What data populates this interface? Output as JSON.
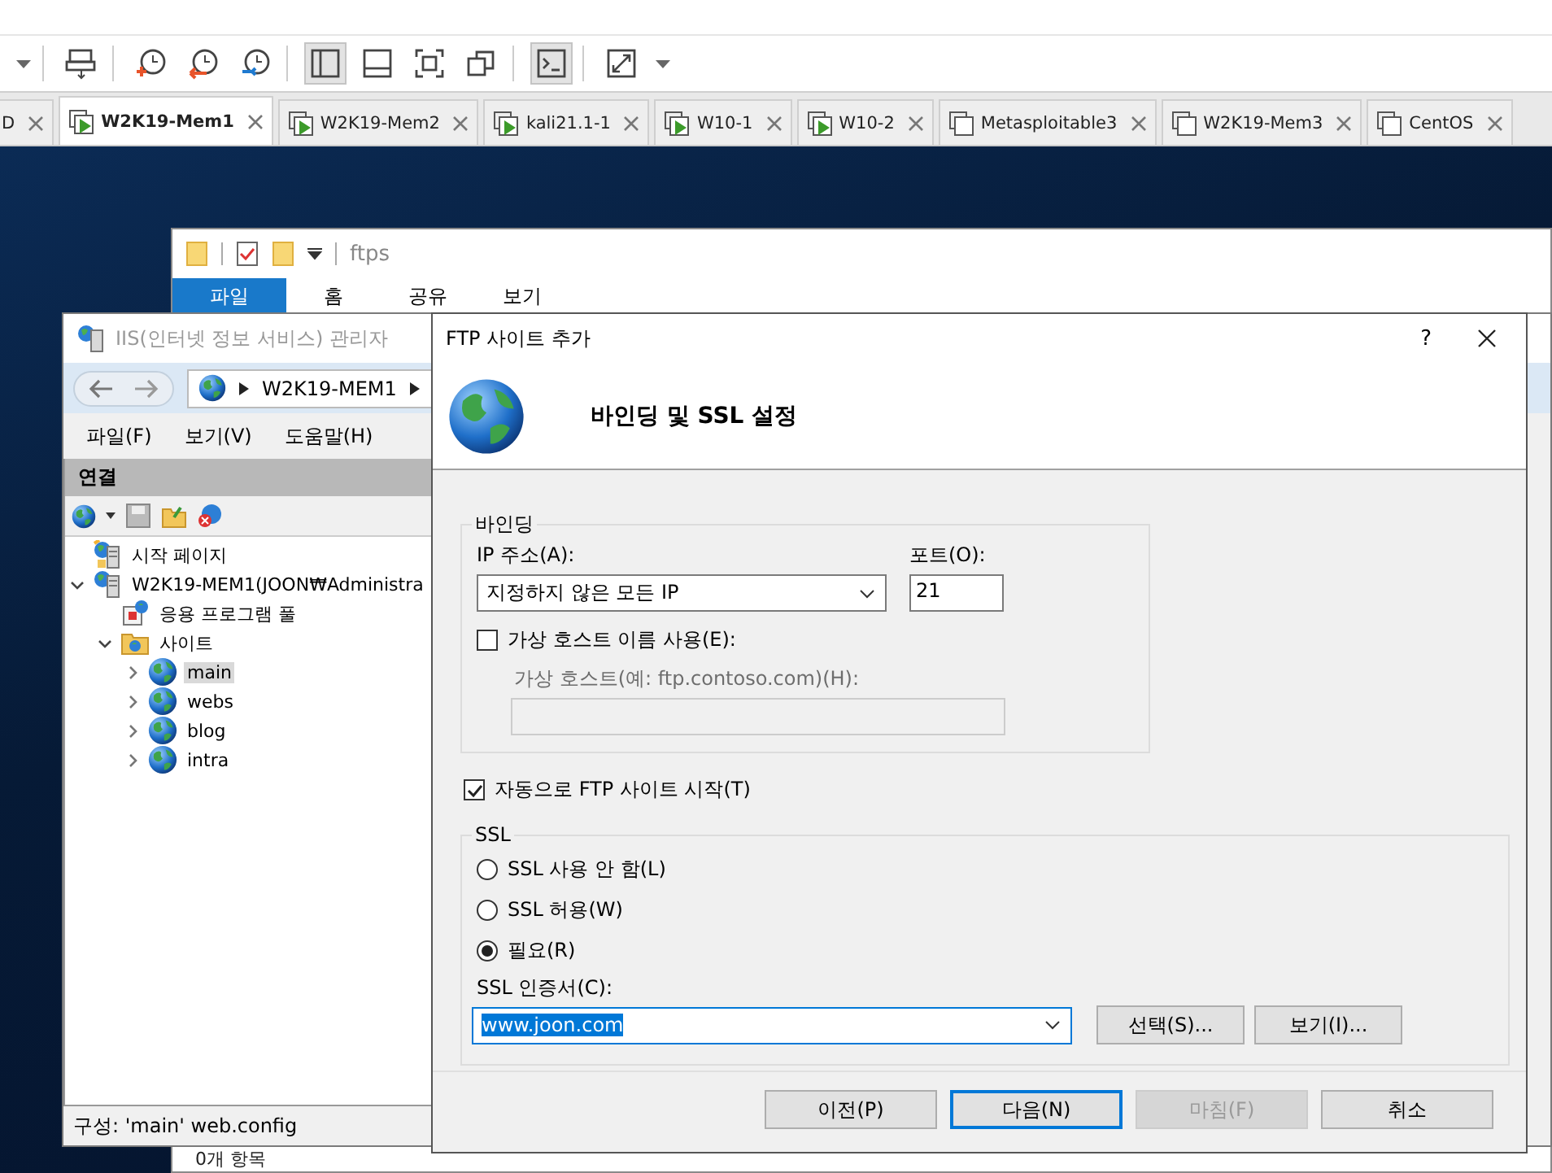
{
  "toolbar": {
    "groups": [
      [
        {
          "kind": "caret",
          "selected": false
        }
      ],
      [
        {
          "kind": "send-keys",
          "selected": false
        }
      ],
      [
        {
          "kind": "snapshot-take",
          "selected": false
        },
        {
          "kind": "snapshot-revert",
          "selected": false
        },
        {
          "kind": "snapshot-manager",
          "selected": false
        }
      ],
      [
        {
          "kind": "library-view",
          "selected": true
        },
        {
          "kind": "thumbnail-bar",
          "selected": false
        },
        {
          "kind": "full-screen",
          "selected": false
        },
        {
          "kind": "unity",
          "selected": false
        }
      ],
      [
        {
          "kind": "console",
          "selected": true
        }
      ],
      [
        {
          "kind": "stretch",
          "selected": false
        },
        {
          "kind": "caret",
          "selected": false
        }
      ]
    ]
  },
  "vm_tabs": [
    {
      "label": "D",
      "selected": false,
      "clipped": true
    },
    {
      "label": "W2K19-Mem1",
      "selected": true,
      "running": true,
      "clipped": false
    },
    {
      "label": "W2K19-Mem2",
      "selected": false,
      "running": true,
      "clipped": false
    },
    {
      "label": "kali21.1-1",
      "selected": false,
      "running": true,
      "clipped": false
    },
    {
      "label": "W10-1",
      "selected": false,
      "running": true,
      "clipped": false
    },
    {
      "label": "W10-2",
      "selected": false,
      "running": true,
      "clipped": false
    },
    {
      "label": "Metasploitable3",
      "selected": false,
      "running": false,
      "clipped": false
    },
    {
      "label": "W2K19-Mem3",
      "selected": false,
      "running": false,
      "clipped": false
    },
    {
      "label": "CentOS",
      "selected": false,
      "running": false,
      "clipped": false
    }
  ],
  "explorer": {
    "path": "ftps",
    "ribbon_tabs": [
      {
        "label": "파일",
        "selected": true
      },
      {
        "label": "홈",
        "selected": false
      },
      {
        "label": "공유",
        "selected": false
      },
      {
        "label": "보기",
        "selected": false
      }
    ],
    "status": "0개 항목"
  },
  "iis": {
    "title": "IIS(인터넷 정보 서비스) 관리자",
    "active": false,
    "breadcrumb": "W2K19-MEM1",
    "menu": [
      "파일(F)",
      "보기(V)",
      "도움말(H)"
    ],
    "connections": {
      "title": "연결",
      "tree": [
        {
          "label": "시작 페이지",
          "kind": "start-page",
          "selected": false
        },
        {
          "label": "W2K19-MEM1(JOON₩Administra",
          "kind": "server",
          "selected": false,
          "expanded": true,
          "children": [
            {
              "label": "응용 프로그램 풀",
              "kind": "app-pools",
              "selected": false
            },
            {
              "label": "사이트",
              "kind": "sites",
              "selected": false,
              "expanded": true,
              "children": [
                {
                  "label": "main",
                  "kind": "site",
                  "selected": true,
                  "expanded": false
                },
                {
                  "label": "webs",
                  "kind": "site",
                  "selected": false,
                  "expanded": false
                },
                {
                  "label": "blog",
                  "kind": "site",
                  "selected": false,
                  "expanded": false
                },
                {
                  "label": "intra",
                  "kind": "site",
                  "selected": false,
                  "expanded": false
                }
              ]
            }
          ]
        }
      ]
    },
    "status": "구성: 'main' web.config"
  },
  "dialog": {
    "title": "FTP 사이트 추가",
    "help": "?",
    "heading": "바인딩 및 SSL 설정",
    "binding": {
      "legend": "바인딩",
      "ip_label": "IP 주소(A):",
      "ip_value": "지정하지 않은 모든 IP",
      "port_label": "포트(O):",
      "port_value": "21",
      "virtual_host": {
        "label": "가상 호스트 이름 사용(E):",
        "checked": false
      },
      "host_label": "가상 호스트(예: ftp.contoso.com)(H):",
      "host_disabled": true
    },
    "auto_start": {
      "label": "자동으로 FTP 사이트 시작(T)",
      "checked": true
    },
    "ssl": {
      "legend": "SSL",
      "options": [
        {
          "label": "SSL 사용 안 함(L)",
          "selected": false
        },
        {
          "label": "SSL 허용(W)",
          "selected": false
        },
        {
          "label": "필요(R)",
          "selected": true
        }
      ],
      "cert_label": "SSL 인증서(C):",
      "cert_value": "www.joon.com",
      "cert_buttons": [
        "선택(S)...",
        "보기(I)..."
      ]
    },
    "buttons": [
      {
        "label": "이전(P)",
        "default": false,
        "disabled": false
      },
      {
        "label": "다음(N)",
        "default": true,
        "disabled": false
      },
      {
        "label": "마침(F)",
        "default": false,
        "disabled": true
      },
      {
        "label": "취소",
        "default": false,
        "disabled": false
      }
    ]
  }
}
